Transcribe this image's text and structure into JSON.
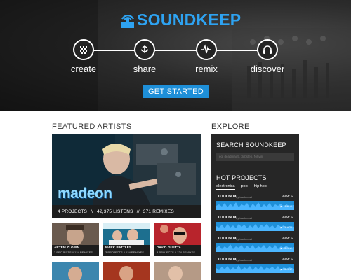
{
  "brand": {
    "name": "SOUNDKEEP",
    "accent": "#2ea3f2"
  },
  "steps": [
    {
      "label": "create",
      "icon": "grid-icon"
    },
    {
      "label": "share",
      "icon": "share-arrow-icon"
    },
    {
      "label": "remix",
      "icon": "waveform-icon"
    },
    {
      "label": "discover",
      "icon": "headphones-icon"
    }
  ],
  "cta": {
    "label": "GET STARTED"
  },
  "featured": {
    "title": "FEATURED ARTISTS",
    "main": {
      "name_logo": "madeon",
      "projects": "4 PROJECTS",
      "listens": "42,375 LISTENS",
      "remixes": "371 REMIXES",
      "sep": "//"
    },
    "cards": [
      {
        "name": "ARTEM ZLOBIN",
        "stats": "3 PROJECTS // 124 REMIXES"
      },
      {
        "name": "MARK BATTLES",
        "stats": "3 PROJECTS // 124 REMIXES"
      },
      {
        "name": "DAVID GUETTA",
        "stats": "3 PROJECTS // 124 REMIXES"
      }
    ]
  },
  "explore": {
    "title": "EXPLORE",
    "search_title": "SEARCH SOUNDKEEP",
    "search_placeholder": "eg. deadmau5, dubstep, Nihvin",
    "hot_title": "HOT PROJECTS",
    "genres": [
      "electronica",
      "pop",
      "hip hop"
    ],
    "tracks": [
      {
        "title": "TOOLBOX",
        "by": "by trackhead",
        "view": "view »"
      },
      {
        "title": "TOOLBOX",
        "by": "by trackhead",
        "view": "view »"
      },
      {
        "title": "TOOLBOX",
        "by": "by trackhead",
        "view": "view »"
      },
      {
        "title": "TOOLBOX",
        "by": "by trackhead",
        "view": "view »"
      }
    ],
    "track_meta": "▶ 33  ✉ 12"
  }
}
